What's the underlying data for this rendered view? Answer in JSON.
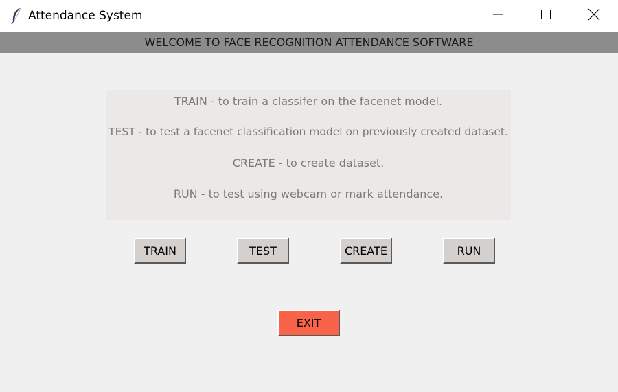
{
  "window": {
    "title": "Attendance System",
    "icon": "feather-icon",
    "controls": [
      "minimize-icon",
      "maximize-icon",
      "close-icon"
    ]
  },
  "banner": {
    "text": "WELCOME TO FACE RECOGNITION ATTENDANCE SOFTWARE"
  },
  "info": {
    "lines": [
      "TRAIN - to train a classifer on the facenet model.",
      "TEST - to test a facenet classification model on previously created dataset.",
      "CREATE - to create dataset.",
      "RUN - to test using webcam or mark attendance."
    ]
  },
  "buttons": {
    "train": "TRAIN",
    "test": "TEST",
    "create": "CREATE",
    "run": "RUN",
    "exit": "EXIT"
  },
  "colors": {
    "banner_bg": "#8c8c8c",
    "exit_bg": "#f9634a",
    "button_bg": "#d4d0cd",
    "info_bg": "#ebe9e8"
  }
}
